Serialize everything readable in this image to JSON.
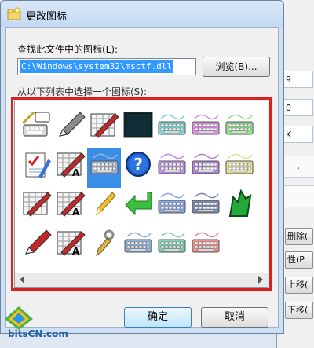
{
  "dialog": {
    "title": "更改图标",
    "find_label": "查找此文件中的图标(L):",
    "path_value": "C:\\Windows\\system32\\msctf.dll",
    "browse_label": "浏览(B)...",
    "choose_label": "从以下列表中选择一个图标(S):",
    "ok_label": "确定",
    "cancel_label": "取消"
  },
  "icons": [
    "keyboard-pen-chat-icon",
    "pen-gray-icon",
    "palette-pen-red-icon",
    "black-tile-icon",
    "keyboard-cyan-icon",
    "keyboard-magenta-icon",
    "keyboard-green-icon",
    "checklist-pen-icon",
    "pen-red-a-icon",
    "keyboard-selected-icon",
    "help-question-icon",
    "keyboard-purple-icon",
    "keyboard-violet-icon",
    "keyboard-yellow-icon",
    "palette-pen-icon",
    "palette-pen-a-icon",
    "pen-yellow-icon",
    "arrow-green-left-icon",
    "keyboard-blue-icon",
    "keyboard-dark-icon",
    "green-figure-icon",
    "pen-red-icon",
    "pen-a-dotted-icon",
    "brush-gray-icon",
    "keyboard-steelblue-icon",
    "keyboard-teal-icon",
    "keyboard-red-icon"
  ],
  "background_window": {
    "cell_top": "9",
    "cell_mid": "0",
    "cell_k": "K",
    "delete_label": "删除(",
    "prop_label": "性(P",
    "moveup_label": "上移(",
    "movedown_label": "下移("
  },
  "watermark": {
    "text": "bitsCN.com"
  },
  "colors": {
    "selection": "#3399ff",
    "highlight_frame": "#d9221f",
    "title_bar": "#c3d8f0"
  }
}
